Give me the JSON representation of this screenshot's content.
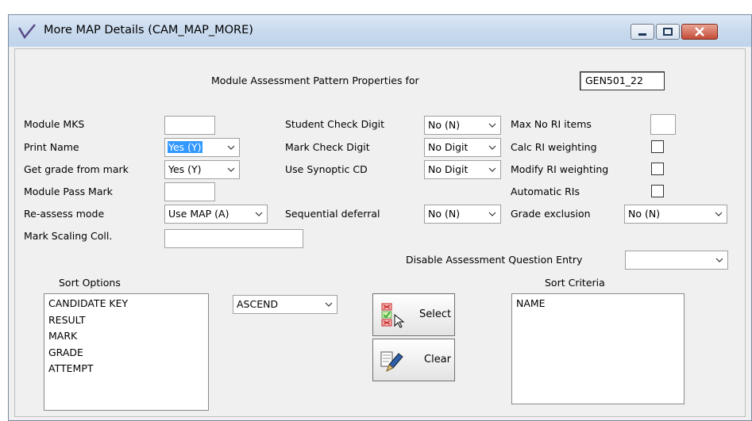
{
  "window": {
    "title": "More MAP Details (CAM_MAP_MORE)"
  },
  "header": {
    "label": "Module Assessment Pattern Properties for",
    "code": "GEN501_22"
  },
  "left": {
    "module_mks": {
      "label": "Module MKS",
      "value": ""
    },
    "print_name": {
      "label": "Print Name",
      "value": "Yes (Y)"
    },
    "grade_from_mark": {
      "label": "Get grade from mark",
      "value": "Yes (Y)"
    },
    "pass_mark": {
      "label": "Module Pass Mark",
      "value": ""
    },
    "reassess": {
      "label": "Re-assess mode",
      "value": "Use MAP (A)"
    },
    "scaling": {
      "label": "Mark Scaling Coll.",
      "value": ""
    }
  },
  "middle": {
    "student_check": {
      "label": "Student Check Digit",
      "value": "No (N)"
    },
    "mark_check": {
      "label": "Mark Check Digit",
      "value": "No Digit"
    },
    "synoptic": {
      "label": "Use Synoptic CD",
      "value": "No Digit"
    },
    "sequential": {
      "label": "Sequential deferral",
      "value": "No (N)"
    }
  },
  "right": {
    "max_ri": {
      "label": "Max No RI items",
      "value": ""
    },
    "calc_ri": {
      "label": "Calc RI weighting",
      "checked": false
    },
    "modify_ri": {
      "label": "Modify RI weighting",
      "checked": false
    },
    "auto_ri": {
      "label": "Automatic RIs",
      "checked": false
    },
    "grade_excl": {
      "label": "Grade exclusion",
      "value": "No (N)"
    },
    "disable_q": {
      "label": "Disable Assessment Question Entry",
      "value": ""
    }
  },
  "sort": {
    "options_label": "Sort Options",
    "options": [
      "CANDIDATE KEY",
      "RESULT",
      "MARK",
      "GRADE",
      "ATTEMPT"
    ],
    "order": "ASCEND",
    "select_label": "Select",
    "clear_label": "Clear",
    "criteria_label": "Sort Criteria",
    "criteria": [
      "NAME"
    ]
  },
  "icons": {
    "title": "app-check-icon",
    "select": "select-list-icon",
    "clear": "eraser-icon"
  }
}
